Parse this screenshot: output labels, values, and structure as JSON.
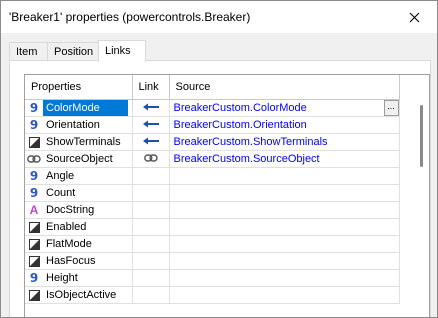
{
  "window": {
    "title": "'Breaker1' properties (powercontrols.Breaker)"
  },
  "tabs": [
    {
      "label": "Item",
      "active": false
    },
    {
      "label": "Position",
      "active": false
    },
    {
      "label": "Links",
      "active": true
    }
  ],
  "grid": {
    "columns": [
      "Properties",
      "Link",
      "Source"
    ],
    "rows": [
      {
        "name": "ColorMode",
        "type_icon": "integer-icon",
        "link_icon": "arrow-left-icon",
        "source": "BreakerCustom.ColorMode",
        "selected": true,
        "ellipsis": "..."
      },
      {
        "name": "Orientation",
        "type_icon": "integer-icon",
        "link_icon": "arrow-left-icon",
        "source": "BreakerCustom.Orientation"
      },
      {
        "name": "ShowTerminals",
        "type_icon": "boolean-icon",
        "link_icon": "arrow-left-icon",
        "source": "BreakerCustom.ShowTerminals"
      },
      {
        "name": "SourceObject",
        "type_icon": "object-icon",
        "link_icon": "chain-link-icon",
        "source": "BreakerCustom.SourceObject"
      },
      {
        "name": "Angle",
        "type_icon": "integer-icon",
        "link_icon": "",
        "source": ""
      },
      {
        "name": "Count",
        "type_icon": "integer-icon",
        "link_icon": "",
        "source": ""
      },
      {
        "name": "DocString",
        "type_icon": "string-icon",
        "link_icon": "",
        "source": ""
      },
      {
        "name": "Enabled",
        "type_icon": "boolean-icon",
        "link_icon": "",
        "source": ""
      },
      {
        "name": "FlatMode",
        "type_icon": "boolean-icon",
        "link_icon": "",
        "source": ""
      },
      {
        "name": "HasFocus",
        "type_icon": "boolean-icon",
        "link_icon": "",
        "source": ""
      },
      {
        "name": "Height",
        "type_icon": "integer-icon",
        "link_icon": "",
        "source": ""
      },
      {
        "name": "IsObjectActive",
        "type_icon": "boolean-icon",
        "link_icon": "",
        "source": ""
      }
    ]
  },
  "colors": {
    "selection": "#0078d7",
    "source_text": "#0000ff",
    "integer_icon": "#2b56c6",
    "string_icon": "#c04ac8",
    "link_arrow": "#1f4fb4"
  }
}
